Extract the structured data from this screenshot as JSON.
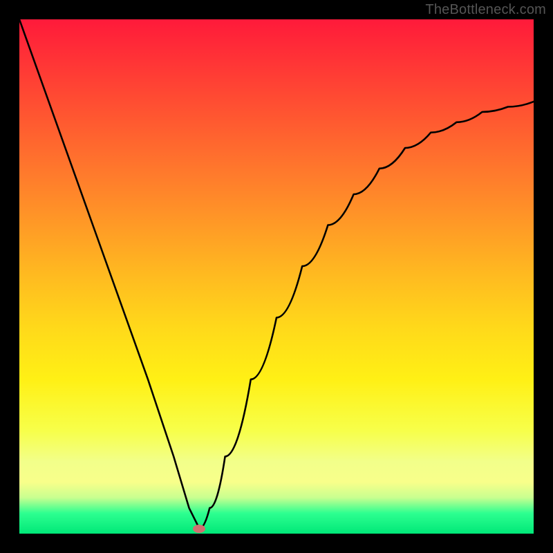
{
  "watermark": "TheBottleneck.com",
  "colors": {
    "frame": "#000000",
    "curve": "#000000",
    "marker": "#d07070",
    "gradient_top": "#ff1a3a",
    "gradient_bottom": "#00e878"
  },
  "chart_data": {
    "type": "line",
    "title": "",
    "xlabel": "",
    "ylabel": "",
    "xlim": [
      0,
      100
    ],
    "ylim": [
      0,
      100
    ],
    "grid": false,
    "legend": false,
    "annotations": [
      "TheBottleneck.com"
    ],
    "description": "V-shaped bottleneck curve over vertical red-to-green gradient. Minimum near x≈35. Left branch nearly straight from top-left to minimum; right branch rises concavely toward upper-right.",
    "series": [
      {
        "name": "bottleneck-curve",
        "x": [
          0,
          5,
          10,
          15,
          20,
          25,
          30,
          33,
          35,
          37,
          40,
          45,
          50,
          55,
          60,
          65,
          70,
          75,
          80,
          85,
          90,
          95,
          100
        ],
        "y": [
          100,
          86,
          72,
          58,
          44,
          30,
          15,
          5,
          1,
          5,
          15,
          30,
          42,
          52,
          60,
          66,
          71,
          75,
          78,
          80,
          82,
          83,
          84
        ]
      }
    ],
    "optimum_marker": {
      "x": 35,
      "y": 1
    }
  }
}
